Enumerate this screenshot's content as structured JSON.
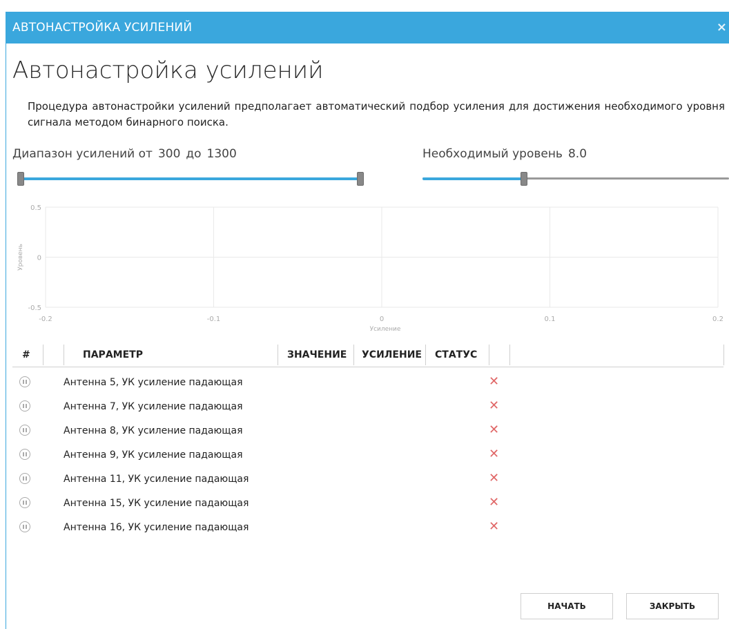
{
  "window": {
    "title": "АВТОНАСТРОЙКА УСИЛЕНИЙ",
    "close_glyph": "×"
  },
  "heading": "Автонастройка усилений",
  "description": "Процедура автонастройки усилений предполагает автоматический подбор усиления для достижения необходимого уровня сигнала методом бинарного поиска.",
  "gain_range": {
    "label_prefix": "Диапазон усилений от",
    "from": "300",
    "to_word": "до",
    "to": "1300"
  },
  "required_level": {
    "label": "Необходимый уровень",
    "value": "8.0",
    "fill_fraction": 0.33
  },
  "chart_data": {
    "type": "line",
    "xlabel": "Усиление",
    "ylabel": "Уровень",
    "xlim": [
      -0.2,
      0.2
    ],
    "ylim": [
      -0.5,
      0.5
    ],
    "x_ticks": [
      "-0.2",
      "-0.1",
      "0",
      "0.1",
      "0.2"
    ],
    "y_ticks": [
      "0.5",
      "0",
      "-0.5"
    ],
    "grid": true,
    "series": []
  },
  "table": {
    "headers": [
      "#",
      "ПАРАМЕТР",
      "ЗНАЧЕНИЕ",
      "УСИЛЕНИЕ",
      "СТАТУС"
    ],
    "rows": [
      {
        "param": "Антенна 5, УК усиление падающая"
      },
      {
        "param": "Антенна 7, УК усиление падающая"
      },
      {
        "param": "Антенна 8, УК усиление падающая"
      },
      {
        "param": "Антенна 9, УК усиление падающая"
      },
      {
        "param": "Антенна 11, УК усиление падающая"
      },
      {
        "param": "Антенна 15, УК усиление падающая"
      },
      {
        "param": "Антенна 16, УК усиление падающая"
      }
    ],
    "delete_glyph": "✕"
  },
  "buttons": {
    "start": "НАЧАТЬ",
    "close": "ЗАКРЫТЬ"
  },
  "colors": {
    "accent": "#3aa7dd",
    "slider_track_inactive": "#999999",
    "delete": "#e06666"
  },
  "icons": {
    "row_status": "pause-circle-icon",
    "row_delete": "close-icon",
    "window_close": "close-icon"
  }
}
